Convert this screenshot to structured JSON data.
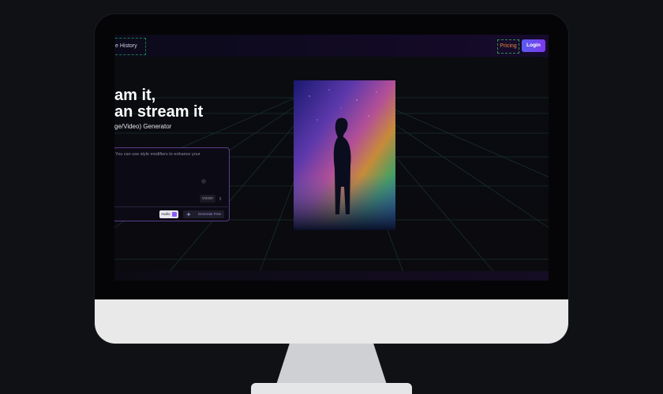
{
  "nav": {
    "history_label": "e History",
    "pricing_label": "Pricing",
    "login_label": "Login"
  },
  "hero": {
    "line1": "am it,",
    "line2": "an stream it",
    "subtitle": "ge/Video) Generator"
  },
  "prompt": {
    "hint": "You can use style modifiers to enhance your",
    "char_count": "0/2000",
    "audio_label": "Audio",
    "generate_label": "Generate Free"
  },
  "colors": {
    "accent": "#7c3aed",
    "pricing": "#e38a3b",
    "card_border": "#5a3e8a"
  },
  "icons": {
    "generate": "sparkle-icon",
    "audio_check": "checkbox-checked-icon",
    "enhance": "magic-wand-icon"
  }
}
